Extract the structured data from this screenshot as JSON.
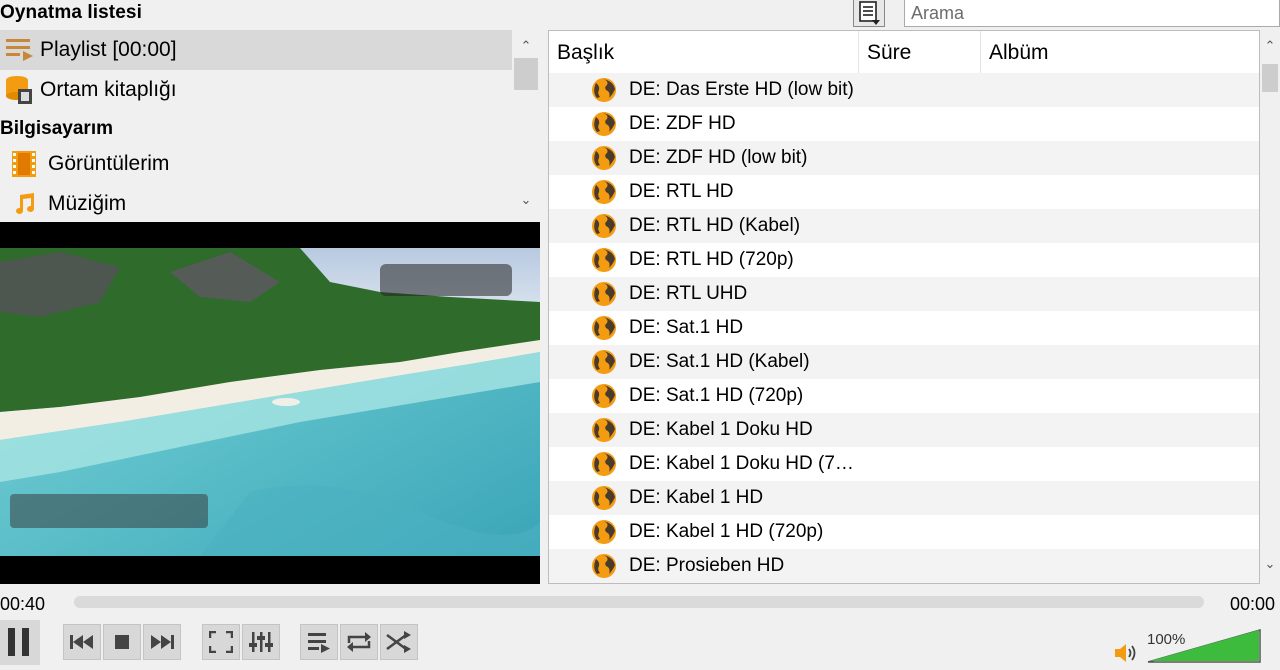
{
  "panel_title": "Oynatma listesi",
  "search": {
    "placeholder": "Arama"
  },
  "sidebar": {
    "items": [
      {
        "label": "Playlist [00:00]",
        "icon": "playlist-icon",
        "selected": true
      },
      {
        "label": "Ortam kitaplığı",
        "icon": "media-library-icon"
      }
    ],
    "section_computer": "Bilgisayarım",
    "computer_items": [
      {
        "label": "Görüntülerim",
        "icon": "film-icon"
      },
      {
        "label": "Müziğim",
        "icon": "music-note-icon"
      }
    ]
  },
  "table": {
    "columns": [
      "Başlık",
      "Süre",
      "Albüm"
    ],
    "rows": [
      "DE: Das Erste HD (low bit)",
      "DE: ZDF HD",
      "DE: ZDF HD (low bit)",
      "DE: RTL HD",
      "DE: RTL HD (Kabel)",
      "DE: RTL HD (720p)",
      "DE: RTL UHD",
      "DE: Sat.1 HD",
      "DE: Sat.1 HD (Kabel)",
      "DE: Sat.1 HD (720p)",
      "DE: Kabel 1 Doku HD",
      "DE: Kabel 1 Doku HD (7…",
      "DE: Kabel 1 HD",
      "DE: Kabel 1 HD (720p)",
      "DE: Prosieben HD"
    ]
  },
  "player": {
    "time_elapsed": "00:40",
    "time_total": "00:00",
    "volume": "100%",
    "volume_level": 1.0
  },
  "colors": {
    "accent_orange": "#f39c12",
    "volume_green": "#3dbb3d"
  }
}
